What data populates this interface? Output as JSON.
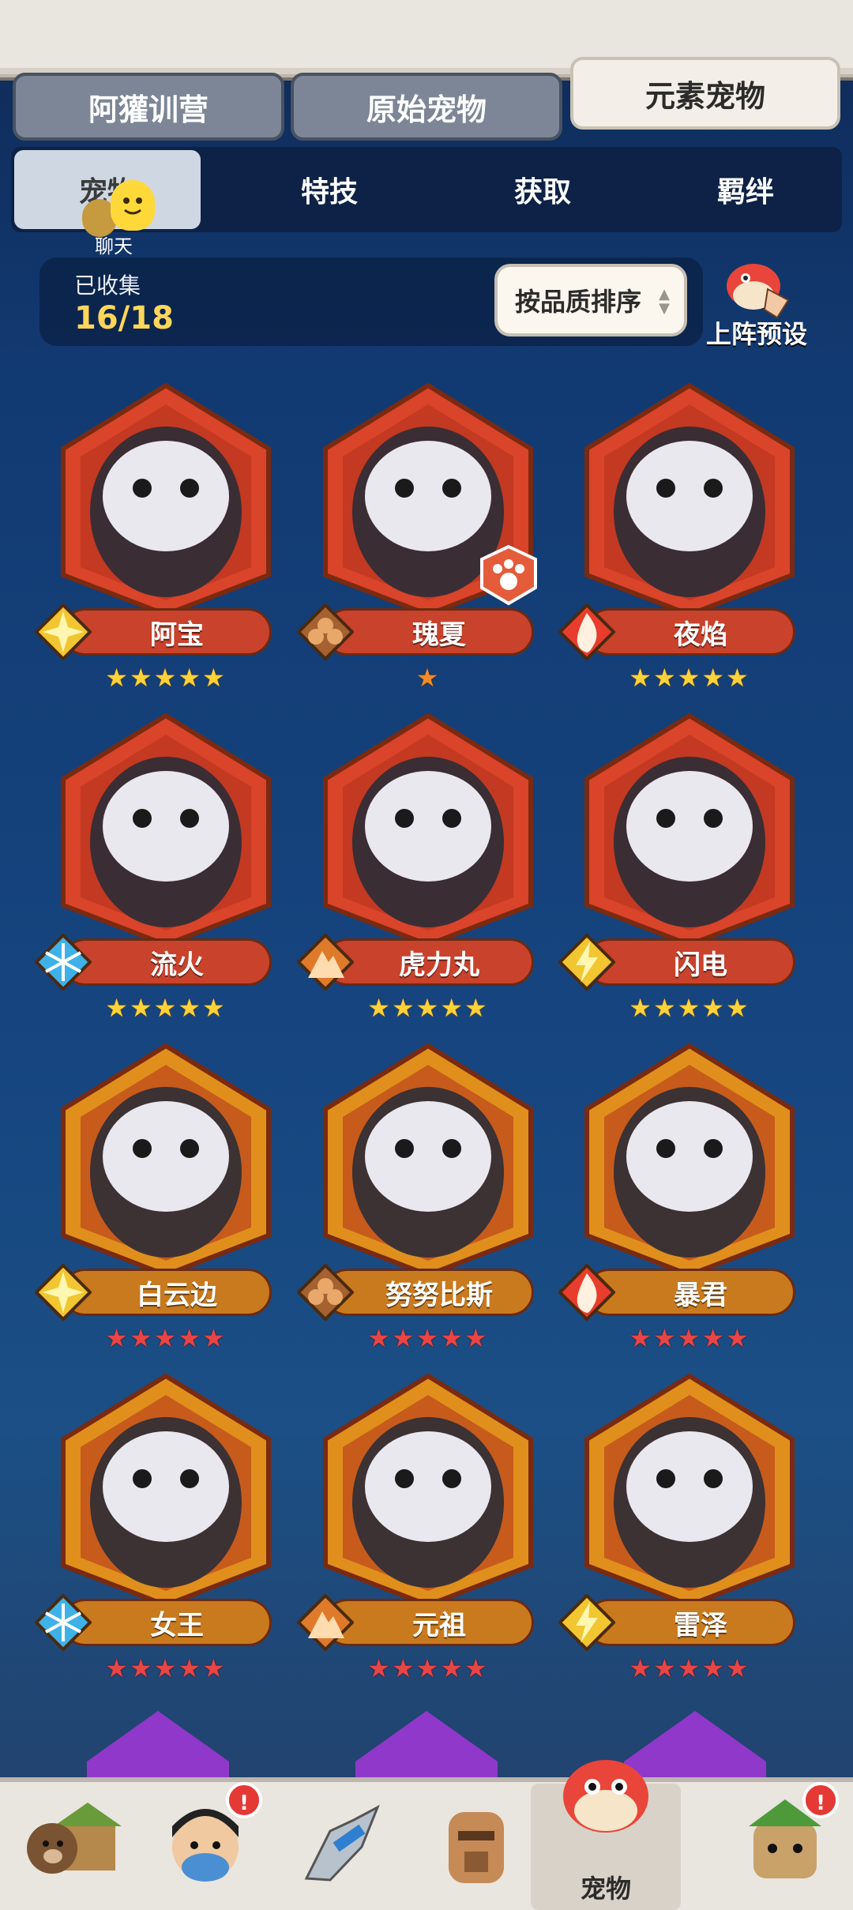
{
  "top_tabs": [
    {
      "label": "阿獾训营",
      "active": false
    },
    {
      "label": "原始宠物",
      "active": false
    },
    {
      "label": "元素宠物",
      "active": true
    }
  ],
  "sub_tabs": [
    {
      "label": "宠物",
      "active": true
    },
    {
      "label": "特技",
      "active": false
    },
    {
      "label": "获取",
      "active": false
    },
    {
      "label": "羁绊",
      "active": false
    }
  ],
  "chat": {
    "label": "聊天"
  },
  "collection": {
    "label": "已收集",
    "value": "16/18"
  },
  "sort": {
    "label": "按品质排序"
  },
  "preset": {
    "label": "上阵预设"
  },
  "pets": [
    {
      "name": "阿宝",
      "element": "light-icon",
      "stars": 5,
      "star_color": "gold",
      "frame": "red"
    },
    {
      "name": "瑰夏",
      "element": "earth-icon",
      "stars": 1,
      "star_color": "orange",
      "frame": "red",
      "badge": "paw-icon"
    },
    {
      "name": "夜焰",
      "element": "fire-icon",
      "stars": 5,
      "star_color": "gold",
      "frame": "red"
    },
    {
      "name": "流火",
      "element": "ice-icon",
      "stars": 5,
      "star_color": "gold",
      "frame": "red"
    },
    {
      "name": "虎力丸",
      "element": "mountain-icon",
      "stars": 5,
      "star_color": "gold",
      "frame": "red"
    },
    {
      "name": "闪电",
      "element": "lightning-icon",
      "stars": 5,
      "star_color": "gold",
      "frame": "red"
    },
    {
      "name": "白云边",
      "element": "light-icon",
      "stars": 5,
      "star_color": "red",
      "frame": "gold"
    },
    {
      "name": "努努比斯",
      "element": "earth-icon",
      "stars": 5,
      "star_color": "red",
      "frame": "gold"
    },
    {
      "name": "暴君",
      "element": "fire-icon",
      "stars": 5,
      "star_color": "red",
      "frame": "gold"
    },
    {
      "name": "女王",
      "element": "ice-icon",
      "stars": 5,
      "star_color": "red",
      "frame": "gold"
    },
    {
      "name": "元祖",
      "element": "mountain-icon",
      "stars": 5,
      "star_color": "red",
      "frame": "gold"
    },
    {
      "name": "雷泽",
      "element": "lightning-icon",
      "stars": 5,
      "star_color": "red",
      "frame": "gold"
    }
  ],
  "bottom_nav": [
    {
      "icon": "bear-house-icon",
      "label": "",
      "badge": false
    },
    {
      "icon": "hero-icon",
      "label": "",
      "badge": true
    },
    {
      "icon": "weapon-icon",
      "label": "",
      "badge": false
    },
    {
      "icon": "totem-icon",
      "label": "",
      "badge": false
    },
    {
      "icon": "pet-dino-icon",
      "label": "宠物",
      "badge": false,
      "active": true
    },
    {
      "icon": "tribe-icon",
      "label": "",
      "badge": true
    }
  ],
  "badge_text": "!",
  "colors": {
    "frame_red": "#d9442a",
    "frame_gold": "#e08f1d",
    "namebar_red": "#c9422c",
    "namebar_gold": "#c97a1e"
  }
}
